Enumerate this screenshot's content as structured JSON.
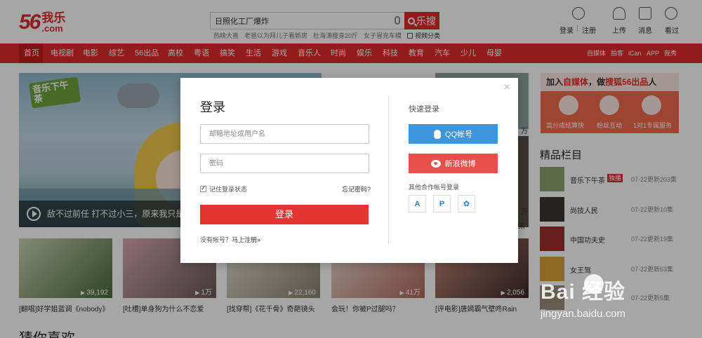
{
  "header": {
    "logo_num": "56",
    "logo_cn": "我乐",
    "logo_com": ".com",
    "search": {
      "value": "日照化工厂爆炸",
      "button": "乐搜"
    },
    "hotwords": [
      "热映大喜",
      "老爸以为拜儿子看新房",
      "杜海涛瘦身20斤",
      "女子冒充车模"
    ],
    "video_category": "视频分类",
    "actions": [
      {
        "icon": "user-icon",
        "label": "登录"
      },
      {
        "icon": "upload-icon",
        "label": "上传"
      },
      {
        "icon": "message-icon",
        "label": "消息"
      },
      {
        "icon": "history-icon",
        "label": "看过"
      }
    ],
    "register_label": "注册",
    "separator": "|"
  },
  "nav": {
    "items": [
      "首页",
      "电视剧",
      "电影",
      "综艺",
      "56出品",
      "高校",
      "粤语",
      "搞笑",
      "生活",
      "游戏",
      "音乐人",
      "时尚",
      "娱乐",
      "科技",
      "教育",
      "汽车",
      "少儿",
      "母婴"
    ],
    "right": [
      "自媒体",
      "拍客",
      "iCan",
      "APP",
      "我秀"
    ],
    "active": "首页"
  },
  "content": {
    "hero_tag": "音乐下午茶",
    "hero_caption": "敌不过前任  打不过小三，原来我只是",
    "mid_overflow": [
      "万",
      "万",
      "来"
    ],
    "thumbs": [
      {
        "count": "39,192",
        "title": "[翻唱]好学姐蓝调《nobody》"
      },
      {
        "count": "1万",
        "title": "[吐槽]单身狗为什么不恋爱"
      },
      {
        "count": "22,160",
        "title": "[找穿帮]《花千骨》奇葩镜头"
      },
      {
        "count": "41万",
        "title": "会玩！你被P过腿吗？"
      },
      {
        "count": "2,056",
        "title": "[评电影]唐嫣霸气壁咚Rain"
      }
    ],
    "guess_title": "猜你喜欢"
  },
  "side": {
    "ad_title_prefix": "加入",
    "ad_title_hl1": "自媒体",
    "ad_title_mid": "，做",
    "ad_title_hl2": "搜狐56出品",
    "ad_title_suffix": "人",
    "ad_features": [
      "高分成结算快",
      "粉丝互动",
      "1对1专属服务"
    ],
    "quality_title": "精品栏目",
    "quality_items": [
      {
        "name": "音乐下午茶",
        "badge": "独播",
        "date": "07-22更新203集"
      },
      {
        "name": "尚技人民",
        "badge": "",
        "date": "07-22更新10集"
      },
      {
        "name": "中国功夫史",
        "badge": "",
        "date": "07-22更新19集"
      },
      {
        "name": "女王驾",
        "badge": "",
        "date": "07-22更新53集"
      },
      {
        "name": "",
        "badge": "",
        "date": "07-22更新5集"
      }
    ]
  },
  "login_modal": {
    "close": "×",
    "title": "登录",
    "username_placeholder": "邮箱地址或用户名",
    "password_placeholder": "密码",
    "remember": "记住登录状态",
    "forgot": "忘记密码?",
    "submit": "登录",
    "no_account": "没有帐号？",
    "register_now": "马上注册»",
    "quick_title": "快速登录",
    "qq": "QQ帐号",
    "weibo": "新浪微博",
    "other_title": "其他合作帐号登录",
    "partners": [
      "A",
      "P",
      "✿"
    ]
  },
  "watermark": {
    "main": "Bai  经验",
    "sub": "jingyan.baidu.com"
  }
}
